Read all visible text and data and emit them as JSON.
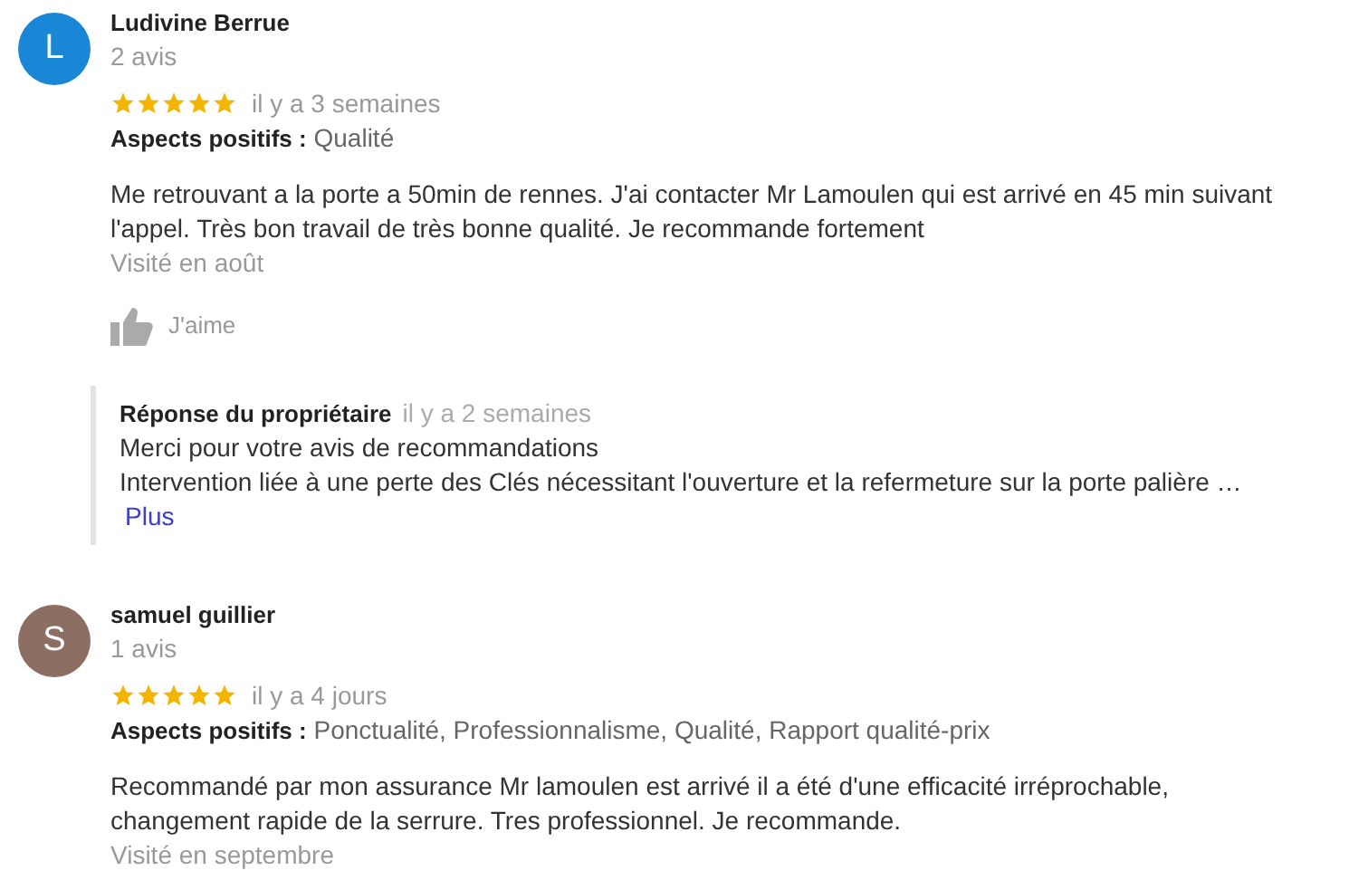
{
  "reviews": [
    {
      "avatar_letter": "L",
      "color": "#1a86d6",
      "author": "Ludivine Berrue",
      "review_count": "2 avis",
      "stars": 5,
      "time": "il y a 3 semaines",
      "aspects_label": "Aspects positifs :",
      "aspects": "Qualité",
      "text": "Me retrouvant a la porte a 50min de rennes. J'ai contacter Mr Lamoulen qui est arrivé en 45 min suivant l'appel. Très bon travail de très bonne qualité. Je recommande fortement",
      "visited": "Visité en août",
      "like_label": "J'aime",
      "owner_reply": {
        "label": "Réponse du propriétaire",
        "time": "il y a 2 semaines",
        "lines": [
          "Merci pour votre avis de recommandations",
          "Intervention liée à une perte des Clés nécessitant l'ouverture et la refermeture sur la porte palière …"
        ],
        "more": "Plus"
      }
    },
    {
      "avatar_letter": "S",
      "color": "#8d6e63",
      "author": "samuel guillier",
      "review_count": "1 avis",
      "stars": 5,
      "time": "il y a 4 jours",
      "aspects_label": "Aspects positifs :",
      "aspects": "Ponctualité, Professionnalisme, Qualité, Rapport qualité-prix",
      "text": "Recommandé par mon assurance Mr lamoulen est arrivé il a été d'une efficacité irréprochable, changement rapide de la serrure. Tres professionnel. Je recommande.",
      "visited": "Visité en septembre"
    }
  ]
}
